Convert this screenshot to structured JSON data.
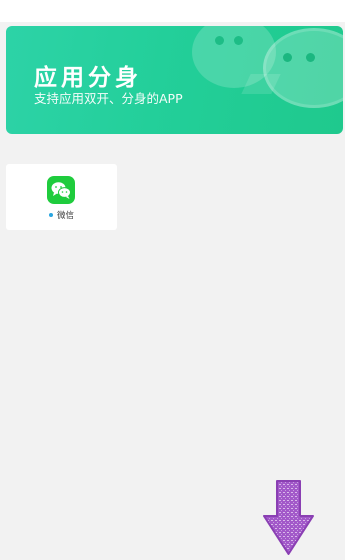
{
  "banner": {
    "title": "应用分身",
    "subtitle": "支持应用双开、分身的APP"
  },
  "apps": [
    {
      "label": "微信",
      "icon": "wechat-icon",
      "status_color": "#2aa5e0"
    }
  ],
  "colors": {
    "banner_gradient_start": "#2dd3a7",
    "banner_gradient_end": "#1fc98d",
    "app_icon_bg": "#1fcc3d",
    "arrow_fill": "#a259c9"
  },
  "overlay": {
    "icon": "down-arrow-icon"
  }
}
